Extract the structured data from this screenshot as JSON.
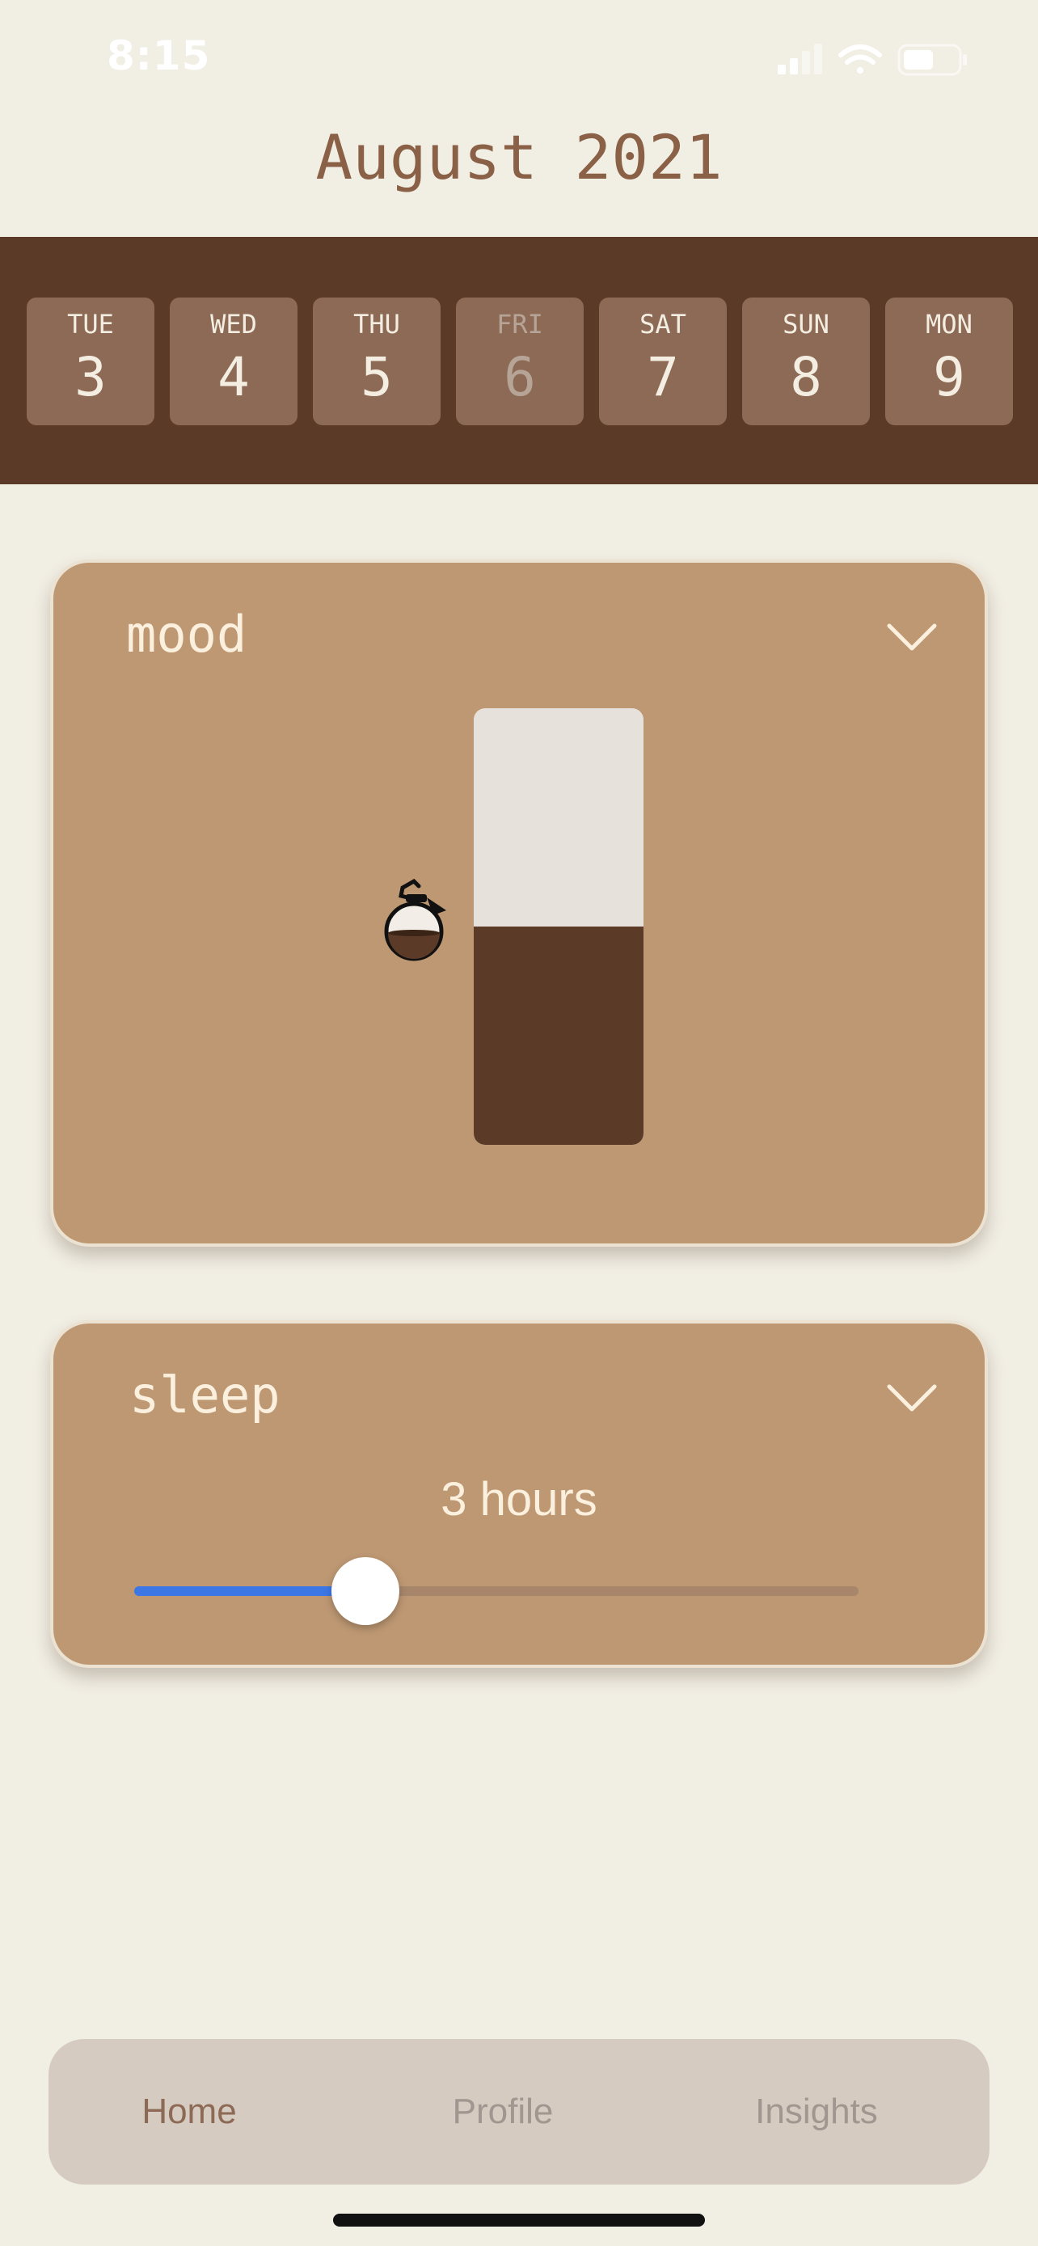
{
  "status": {
    "time": "8:15"
  },
  "header": {
    "month": "August 2021"
  },
  "week": [
    {
      "day": "TUE",
      "date": "3",
      "selected": false
    },
    {
      "day": "WED",
      "date": "4",
      "selected": false
    },
    {
      "day": "THU",
      "date": "5",
      "selected": false
    },
    {
      "day": "FRI",
      "date": "6",
      "selected": true
    },
    {
      "day": "SAT",
      "date": "7",
      "selected": false
    },
    {
      "day": "SUN",
      "date": "8",
      "selected": false
    },
    {
      "day": "MON",
      "date": "9",
      "selected": false
    }
  ],
  "mood": {
    "title": "mood",
    "level": 0.5,
    "icon": "coffee-pot-icon"
  },
  "sleep": {
    "title": "sleep",
    "value_text": "3 hours",
    "value": 3,
    "min": 0,
    "max": 10
  },
  "tabs": [
    {
      "label": "Home",
      "active": true
    },
    {
      "label": "Profile",
      "active": false
    },
    {
      "label": "Insights",
      "active": false
    }
  ],
  "colors": {
    "background": "#f1eee4",
    "brown_dark": "#5b3b28",
    "card": "#be9873",
    "slider_accent": "#3d77e6"
  }
}
